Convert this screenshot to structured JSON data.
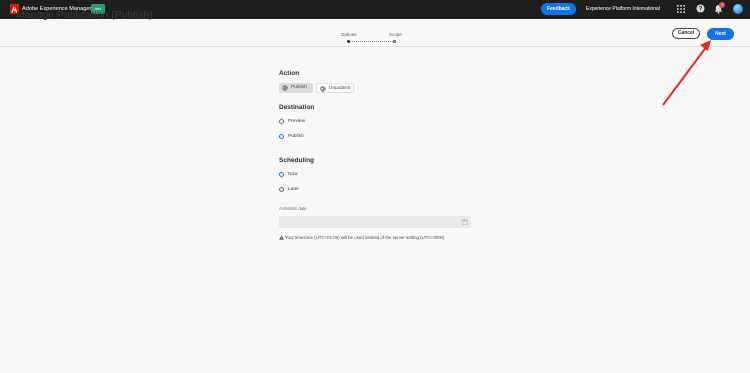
{
  "shell": {
    "app_title": "Adobe Experience Manager",
    "env_badge": "dev",
    "feedback_label": "Feedback",
    "org_name": "Experience Platform International",
    "notification_count": "1"
  },
  "header": {
    "title": "Manage Publication (Publish)",
    "steps": [
      {
        "label": "Options",
        "active": true
      },
      {
        "label": "Scope",
        "active": false
      }
    ],
    "cancel_label": "Cancel",
    "next_label": "Next"
  },
  "form": {
    "action": {
      "heading": "Action",
      "options": [
        {
          "label": "Publish",
          "selected": true
        },
        {
          "label": "Unpublish",
          "selected": false
        }
      ]
    },
    "destination": {
      "heading": "Destination",
      "options": [
        {
          "label": "Preview",
          "checked": false
        },
        {
          "label": "Publish",
          "checked": true
        }
      ]
    },
    "scheduling": {
      "heading": "Scheduling",
      "options": [
        {
          "label": "Now",
          "checked": true
        },
        {
          "label": "Later",
          "checked": false
        }
      ]
    },
    "activation_date_label": "Activation date",
    "activation_date_value": "",
    "timezone_note": "Your timezone (UTC+01:00) will be used instead of the server setting (UTC+0000)"
  },
  "colors": {
    "accent": "#1473e6",
    "annotation_arrow": "#e8291c"
  }
}
